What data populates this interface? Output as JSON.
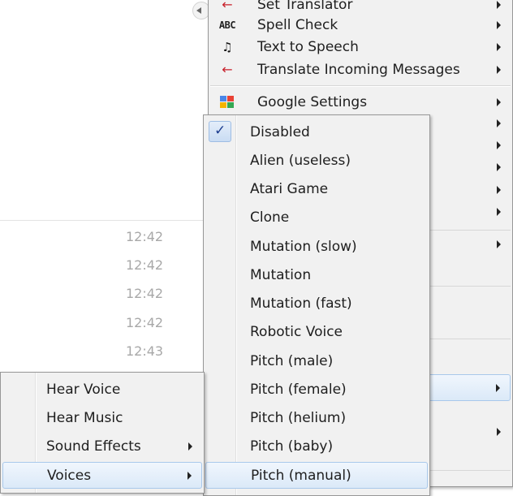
{
  "chat": {
    "timestamps": [
      "12:42",
      "12:42",
      "12:42",
      "12:42",
      "12:43"
    ]
  },
  "main_menu": {
    "items": [
      {
        "label": "Set Translator",
        "icon": "arrow-left-icon"
      },
      {
        "label": "Spell Check",
        "icon": "abc-icon"
      },
      {
        "label": "Text to Speech",
        "icon": "music-note-icon"
      },
      {
        "label": "Translate Incoming Messages",
        "icon": "arrow-left-icon"
      },
      {
        "label": "Google Settings",
        "icon": "google-icon"
      }
    ],
    "colors": {
      "arrow_icon": "#c8202a"
    }
  },
  "voices_menu": {
    "selected": "Disabled",
    "items": [
      "Disabled",
      "Alien (useless)",
      "Atari Game",
      "Clone",
      "Mutation (slow)",
      "Mutation",
      "Mutation (fast)",
      "Robotic Voice",
      "Pitch (male)",
      "Pitch (female)",
      "Pitch (helium)",
      "Pitch (baby)",
      "Pitch (manual)"
    ]
  },
  "sound_menu": {
    "items": [
      {
        "label": "Hear Voice"
      },
      {
        "label": "Hear Music"
      },
      {
        "label": "Sound Effects"
      },
      {
        "label": "Voices"
      }
    ]
  }
}
